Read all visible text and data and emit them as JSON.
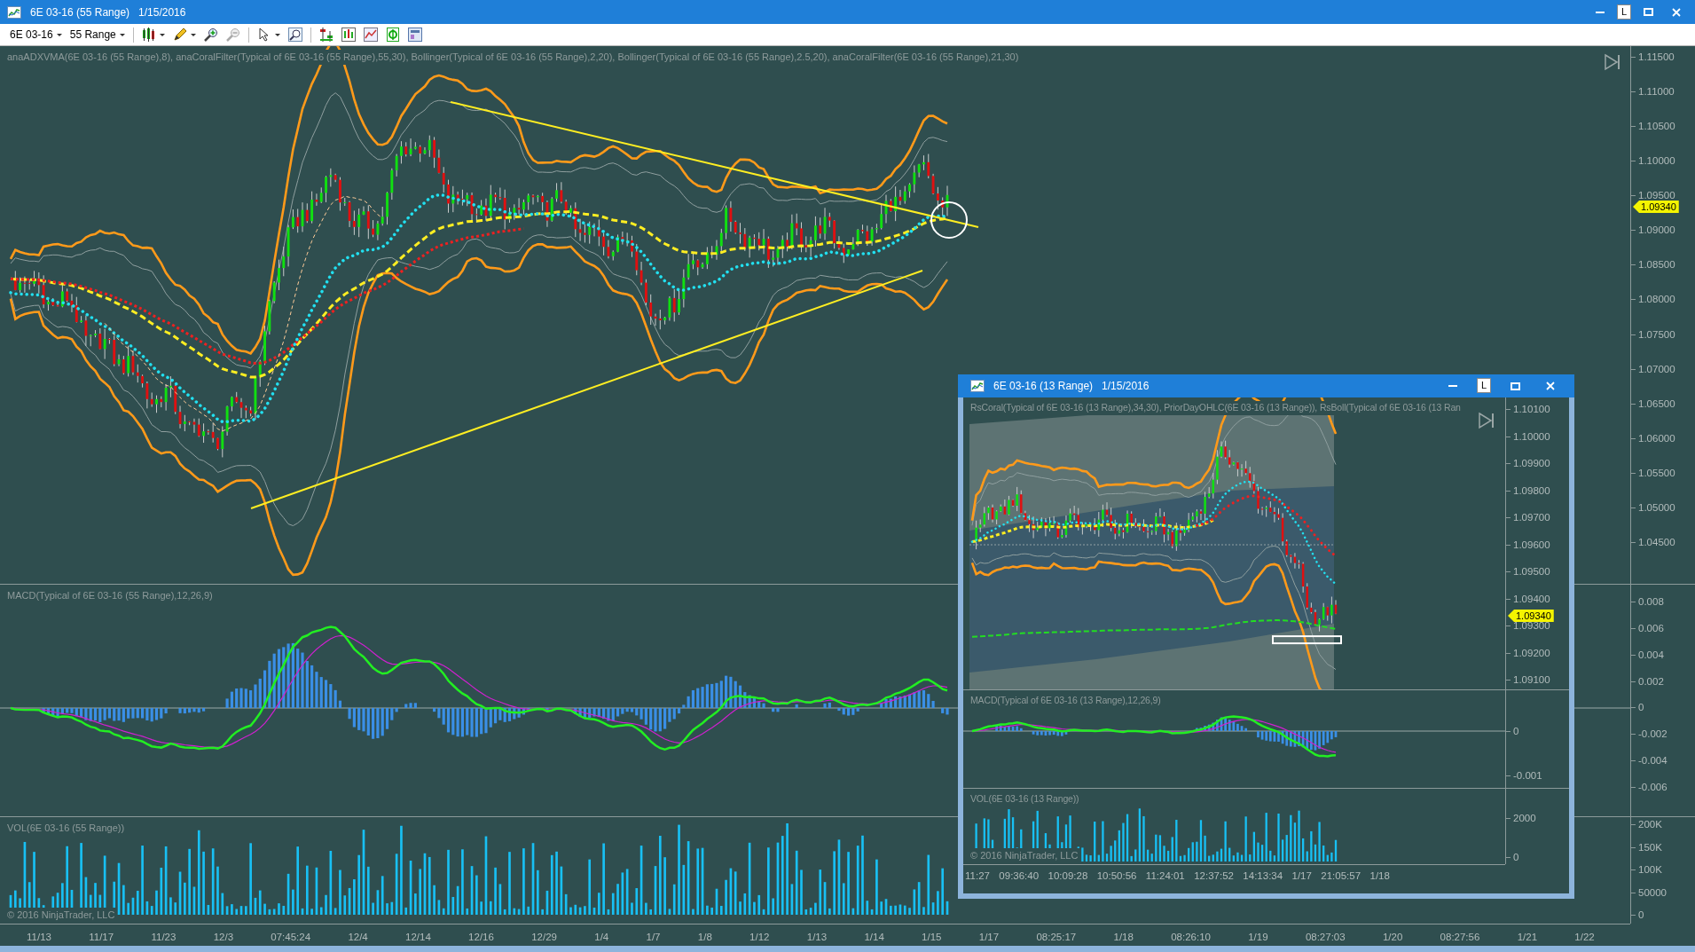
{
  "window": {
    "title": "6E 03-16 (55 Range)",
    "date": "1/15/2016",
    "link_badge": "L"
  },
  "toolbar": {
    "instrument": "6E 03-16",
    "interval": "55 Range"
  },
  "price_panel": {
    "legend": "anaADXVMA(6E 03-16 (55 Range),8), anaCoralFilter(Typical of 6E 03-16 (55 Range),55,30), Bollinger(Typical of 6E 03-16 (55 Range),2,20), Bollinger(Typical of 6E 03-16 (55 Range),2.5,20), anaCoralFilter(6E 03-16 (55 Range),21,30)",
    "y_ticks": [
      "1.11500",
      "1.11000",
      "1.10500",
      "1.10000",
      "1.09500",
      "1.09000",
      "1.08500",
      "1.08000",
      "1.07500",
      "1.07000",
      "1.06500",
      "1.06000",
      "1.05500",
      "1.05000",
      "1.04500"
    ],
    "last_price": "1.09340"
  },
  "macd_panel": {
    "legend": "MACD(Typical of 6E 03-16 (55 Range),12,26,9)",
    "y_ticks": [
      "0.008",
      "0.006",
      "0.004",
      "0.002",
      "0",
      "-0.002",
      "-0.004",
      "-0.006"
    ]
  },
  "volume_panel": {
    "legend": "VOL(6E 03-16 (55 Range))",
    "y_ticks": [
      "200K",
      "150K",
      "100K",
      "50000",
      "0"
    ],
    "copyright": "© 2016 NinjaTrader, LLC"
  },
  "x_axis": [
    "11/13",
    "11/17",
    "11/23",
    "12/3",
    "07:45:24",
    "12/4",
    "12/14",
    "12/16",
    "12/29",
    "1/4",
    "1/7",
    "1/8",
    "1/12",
    "1/13",
    "1/14",
    "1/15",
    "1/17",
    "08:25:17",
    "1/18",
    "08:26:10",
    "1/19",
    "08:27:03",
    "1/20",
    "08:27:56",
    "1/21",
    "1/22"
  ],
  "inset_window": {
    "title": "6E 03-16 (13 Range)",
    "date": "1/15/2016",
    "link_badge": "L",
    "price_panel": {
      "legend": "RsCoral(Typical of 6E 03-16 (13 Range),34,30), PriorDayOHLC(6E 03-16 (13 Range)), RsBoll(Typical of 6E 03-16 (13 Ran",
      "y_ticks": [
        "1.10100",
        "1.10000",
        "1.09900",
        "1.09800",
        "1.09700",
        "1.09600",
        "1.09500",
        "1.09400",
        "1.09300",
        "1.09200",
        "1.09100"
      ],
      "last_price": "1.09340"
    },
    "macd_panel": {
      "legend": "MACD(Typical of 6E 03-16 (13 Range),12,26,9)",
      "y_ticks": [
        "0",
        "-0.001"
      ]
    },
    "volume_panel": {
      "legend": "VOL(6E 03-16 (13 Range))",
      "y_ticks": [
        "2000",
        "0"
      ],
      "copyright": "© 2016 NinjaTrader, LLC"
    },
    "x_axis": [
      "11:27",
      "09:36:40",
      "10:09:28",
      "10:50:56",
      "11:24:01",
      "12:37:52",
      "14:13:34",
      "1/17",
      "21:05:57",
      "1/18"
    ]
  }
}
